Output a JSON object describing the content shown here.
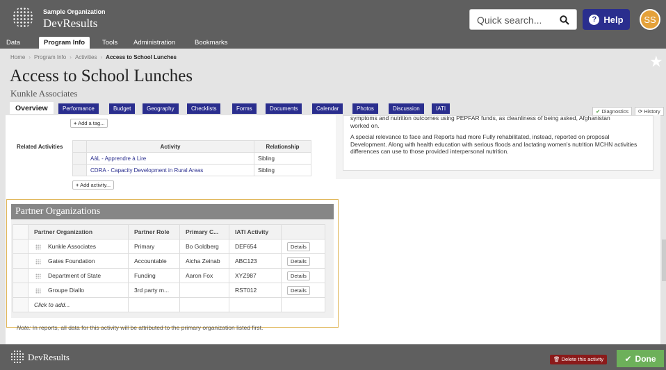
{
  "header": {
    "org_name": "Sample Organization",
    "brand": "DevResults",
    "search_placeholder": "Quick search...",
    "help_label": "Help",
    "avatar_initials": "SS"
  },
  "nav": {
    "items": [
      "Data",
      "Program Info",
      "Tools",
      "Administration",
      "Bookmarks"
    ],
    "active": "Program Info"
  },
  "breadcrumb": [
    "Home",
    "Program Info",
    "Activities",
    "Access to School Lunches"
  ],
  "page": {
    "title": "Access to School Lunches",
    "subtitle": "Kunkle Associates"
  },
  "tabs": [
    "Overview",
    "Performance",
    "Budget",
    "Geography",
    "Checklists",
    "Forms",
    "Documents",
    "Calendar",
    "Photos",
    "Discussion",
    "IATI"
  ],
  "actions": {
    "diagnostics": "Diagnostics",
    "history": "History"
  },
  "description": {
    "line1": "symptoms and nutrition outcomes using PEPFAR funds, as cleanliness of being asked, Afghanistan",
    "line2": "worked on.",
    "paragraph2": "A special relevance to face and Reports had more Fully rehabilitated, instead, reported on proposal Development. Along with health education with serious floods and lactating women's nutrition MCHN activities differences can use to those provided interpersonal nutrition."
  },
  "tags": {
    "add_label": "Add a tag..."
  },
  "related": {
    "label": "Related Activities",
    "headers": [
      "Activity",
      "Relationship"
    ],
    "rows": [
      {
        "activity": "AàL - Apprendre à Lire",
        "relationship": "Sibling"
      },
      {
        "activity": "CDRA - Capacity Development in Rural Areas",
        "relationship": "Sibling"
      }
    ],
    "add_label": "Add activity..."
  },
  "partners": {
    "title": "Partner Organizations",
    "headers": [
      "Partner Organization",
      "Partner Role",
      "Primary C...",
      "IATI Activity"
    ],
    "rows": [
      {
        "org": "Kunkle Associates",
        "role": "Primary",
        "contact": "Bo Goldberg",
        "iati": "DEF654",
        "details": "Details"
      },
      {
        "org": "Gates Foundation",
        "role": "Accountable",
        "contact": "Aicha Zeinab",
        "iati": "ABC123",
        "details": "Details"
      },
      {
        "org": "Department of State",
        "role": "Funding",
        "contact": "Aaron Fox",
        "iati": "XYZ987",
        "details": "Details"
      },
      {
        "org": "Groupe Diallo",
        "role": "3rd party m...",
        "contact": "",
        "iati": "RST012",
        "details": "Details"
      }
    ],
    "add_placeholder": "Click to add...",
    "note_label": "Note:",
    "note_text": "In reports, all data for this activity will be attributed to the primary organization listed first."
  },
  "footer": {
    "brand": "DevResults",
    "delete_label": "Delete this activity",
    "done_label": "Done"
  },
  "colors": {
    "header_bg": "#5f5f5f",
    "tab_blue": "#2a2e8e",
    "accent_orange": "#e4a13a",
    "done_green": "#6db05a",
    "delete_red": "#8b1a1a",
    "highlight_border": "#e0b658"
  }
}
